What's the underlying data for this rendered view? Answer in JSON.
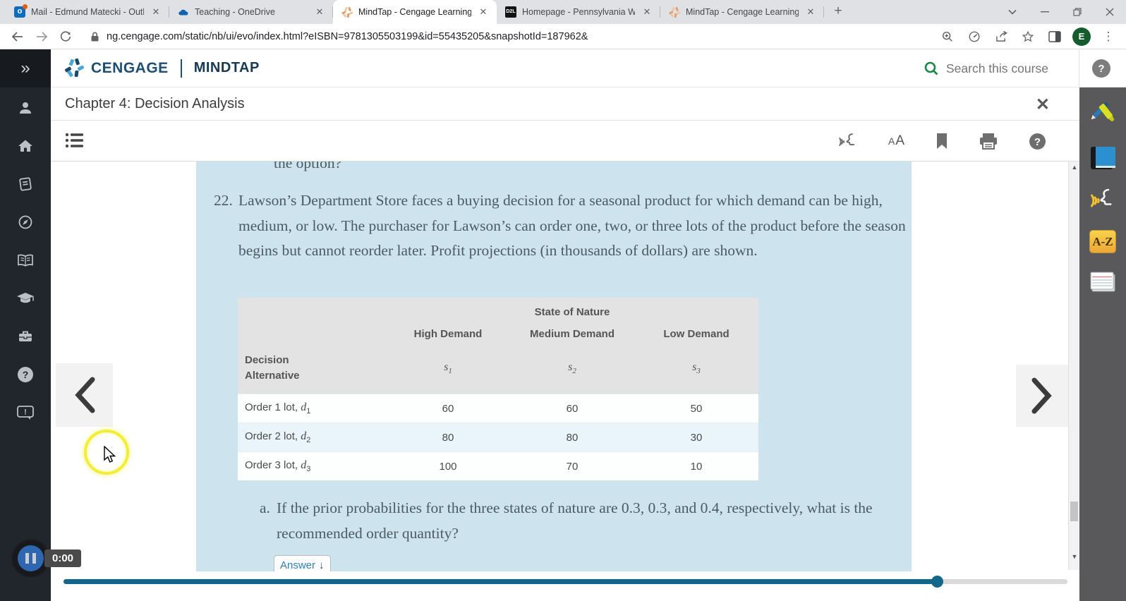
{
  "browser": {
    "tabs": [
      {
        "title": "Mail - Edmund Matecki - Outloo",
        "icon": "outlook-icon",
        "active": false
      },
      {
        "title": "Teaching - OneDrive",
        "icon": "onedrive-icon",
        "active": false
      },
      {
        "title": "MindTap - Cengage Learning",
        "icon": "mindtap-spark-icon",
        "active": true
      },
      {
        "title": "Homepage - Pennsylvania Weste",
        "icon": "d2l-icon",
        "active": false
      },
      {
        "title": "MindTap - Cengage Learning",
        "icon": "mindtap-spark-icon",
        "active": false
      }
    ],
    "close_glyph": "✕",
    "new_tab_glyph": "+",
    "url": "ng.cengage.com/static/nb/ui/evo/index.html?eISBN=9781305503199&id=55435205&snapshotId=187962&",
    "profile_initial": "E",
    "favicon_letters": {
      "outlook": "o",
      "d2l": "D2L"
    },
    "kebab_glyph": "⋮"
  },
  "header": {
    "brand_primary": "CENGAGE",
    "brand_secondary": "MINDTAP",
    "search_placeholder": "Search this course"
  },
  "glyphs": {
    "question": "?",
    "exclaim": "!",
    "expand": "»",
    "up_arrow": "▲",
    "down_arrow": "▼",
    "down_solid": "↓"
  },
  "chapter_bar": {
    "title": "Chapter 4: Decision Analysis",
    "close_glyph": "✕"
  },
  "toolbar": {
    "text_size_small": "A",
    "text_size_large": "A"
  },
  "right_rail_items": [
    {
      "icon": "highlighter-pencil-icon"
    },
    {
      "icon": "ebook-icon"
    },
    {
      "icon": "readspeaker-icon",
      "label": ""
    },
    {
      "icon": "dictionary-icon",
      "label": "A-Z"
    },
    {
      "icon": "notecards-icon"
    }
  ],
  "left_rail_items": [
    {
      "icon": "profile-icon"
    },
    {
      "icon": "home-icon"
    },
    {
      "icon": "notebook-icon"
    },
    {
      "icon": "compass-icon"
    },
    {
      "icon": "open-book-icon"
    },
    {
      "icon": "graduation-cap-icon"
    },
    {
      "icon": "briefcase-icon"
    },
    {
      "icon": "help-icon"
    },
    {
      "icon": "feedback-icon"
    }
  ],
  "reader": {
    "clipped_line": "the option?",
    "problem": {
      "number": "22.",
      "text": "Lawson’s Department Store faces a buying decision for a seasonal product for which demand can be high, medium, or low. The purchaser for Lawson’s can order one, two, or three lots of the product before the season begins but cannot reorder later. Profit projections (in thousands of dollars) are shown."
    },
    "table": {
      "span_header": "State of Nature",
      "row_header_line1": "Decision",
      "row_header_line2": "Alternative",
      "columns": [
        {
          "label": "High Demand",
          "var": "s",
          "sub": "1"
        },
        {
          "label": "Medium Demand",
          "var": "s",
          "sub": "2"
        },
        {
          "label": "Low Demand",
          "var": "s",
          "sub": "3"
        }
      ],
      "rows": [
        {
          "label": "Order 1 lot,",
          "var": "d",
          "sub": "1",
          "values": [
            60,
            60,
            50
          ]
        },
        {
          "label": "Order 2 lot,",
          "var": "d",
          "sub": "2",
          "values": [
            80,
            80,
            30
          ]
        },
        {
          "label": "Order 3 lot,",
          "var": "d",
          "sub": "3",
          "values": [
            100,
            70,
            10
          ]
        }
      ]
    },
    "part_a": {
      "label": "a.",
      "text": "If the prior probabilities for the three states of nature are 0.3, 0.3, and 0.4, respectively, what is the recommended order quantity?"
    },
    "answer_button": "Answer"
  },
  "player": {
    "time": "0:00",
    "progress_pct": 87
  }
}
